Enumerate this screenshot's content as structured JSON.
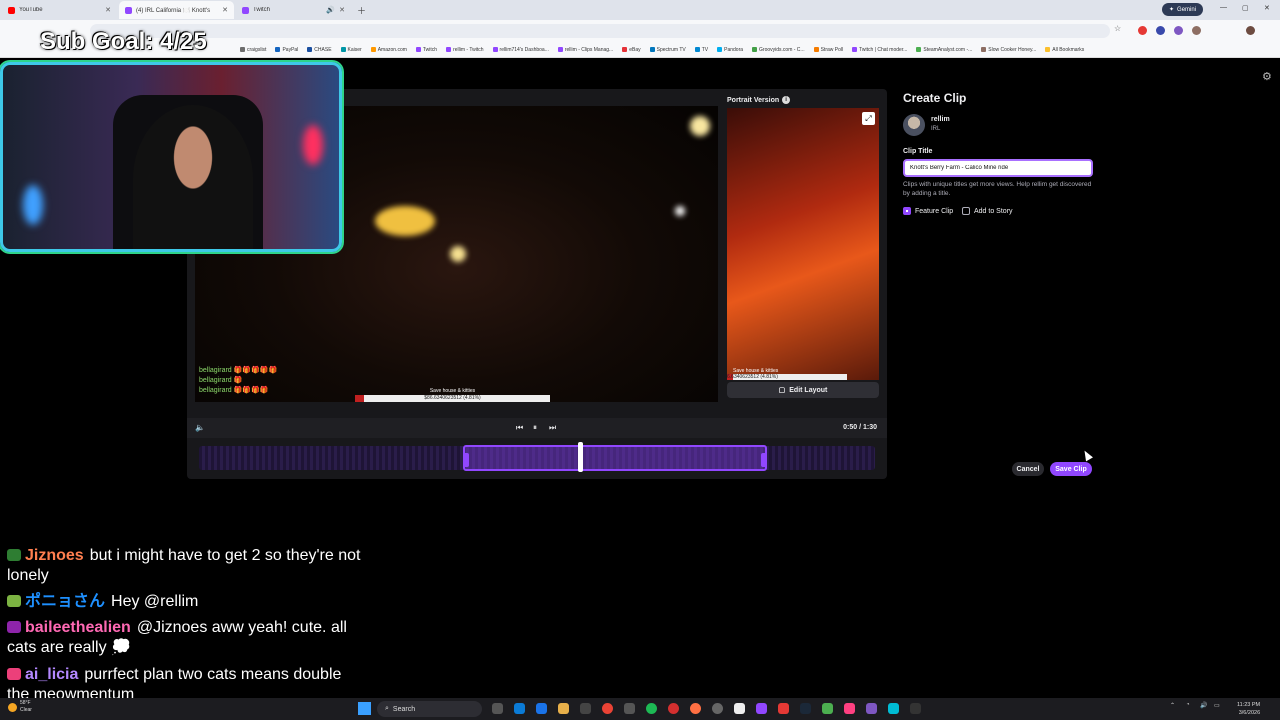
{
  "browser": {
    "tabs": [
      {
        "label": "YouTube",
        "color": "#ff0000",
        "active": false
      },
      {
        "label": "(4) IRL California 🍽️ Knott's",
        "color": "#9147ff",
        "active": true
      },
      {
        "label": "Twitch",
        "color": "#9147ff",
        "active": false
      }
    ],
    "gemini_label": "Gemini",
    "bookmarks": [
      "craigslist",
      "PayPal",
      "CHASE",
      "Kaiser",
      "Amazon.com",
      "Twitch",
      "rellim - Twitch",
      "rellim714's Dashboa...",
      "rellim - Clips Manag...",
      "eBay",
      "Spectrum TV",
      "TV",
      "Pandora",
      "Groovyids.com - C...",
      "Straw Poll",
      "Twitch | Chat moder...",
      "SteamAnalyst.com -...",
      "Slow Cooker Honey...",
      "All Bookmarks"
    ]
  },
  "overlay": {
    "sub_goal": "Sub Goal: 4/25"
  },
  "editor": {
    "chat_lines": [
      "bellagirard 🎁🎁🎁🎁🎁",
      "bellagirard 🎁",
      "bellagirard 🎁🎁🎁🎁"
    ],
    "donation_title": "Save house & kitties",
    "donation_amount": "$86.6340623512 (4.81%)",
    "donation_fraction": 0.0481,
    "portrait_label": "Portrait Version",
    "portrait_donation_title": "Save house & kitties",
    "portrait_donation_amount": "6.6340623512 (4.81%)",
    "edit_layout_label": "Edit Layout",
    "timecode": "0:50 / 1:30",
    "selection_start": 0.39,
    "selection_end": 0.84,
    "playhead_position": 0.56
  },
  "create_clip": {
    "title": "Create Clip",
    "channel_name": "rellim",
    "channel_category": "IRL",
    "clip_title_label": "Clip Title",
    "clip_title_value": "Knott's Berry Farm - Calico Mine ride",
    "help_text": "Clips with unique titles get more views. Help rellim get discovered by adding a title.",
    "feature_clip_label": "Feature Clip",
    "feature_clip_checked": true,
    "add_to_story_label": "Add to Story",
    "add_to_story_checked": false,
    "cancel_label": "Cancel",
    "save_label": "Save Clip"
  },
  "chat": [
    {
      "user": "Jiznoes",
      "color": "#ff7f50",
      "badge": "#2e7d32",
      "text": "but i might have to get 2 so they're not lonely"
    },
    {
      "user": "ポニョさん",
      "color": "#1e90ff",
      "badge": "#7cb342",
      "text": "Hey @rellim"
    },
    {
      "user": "baileethealien",
      "color": "#ff69b4",
      "badge": "#8e24aa",
      "text": "@Jiznoes aww yeah! cute. all cats are really 💭"
    },
    {
      "user": "ai_licia",
      "color": "#b388ff",
      "badge": "#ec407a",
      "text": "purrfect plan two cats means double the meowmentum"
    }
  ],
  "taskbar": {
    "weather_temp": "58°F",
    "weather_desc": "Clear",
    "search_label": "Search",
    "time": "11:23 PM",
    "date": "3/6/2026"
  }
}
